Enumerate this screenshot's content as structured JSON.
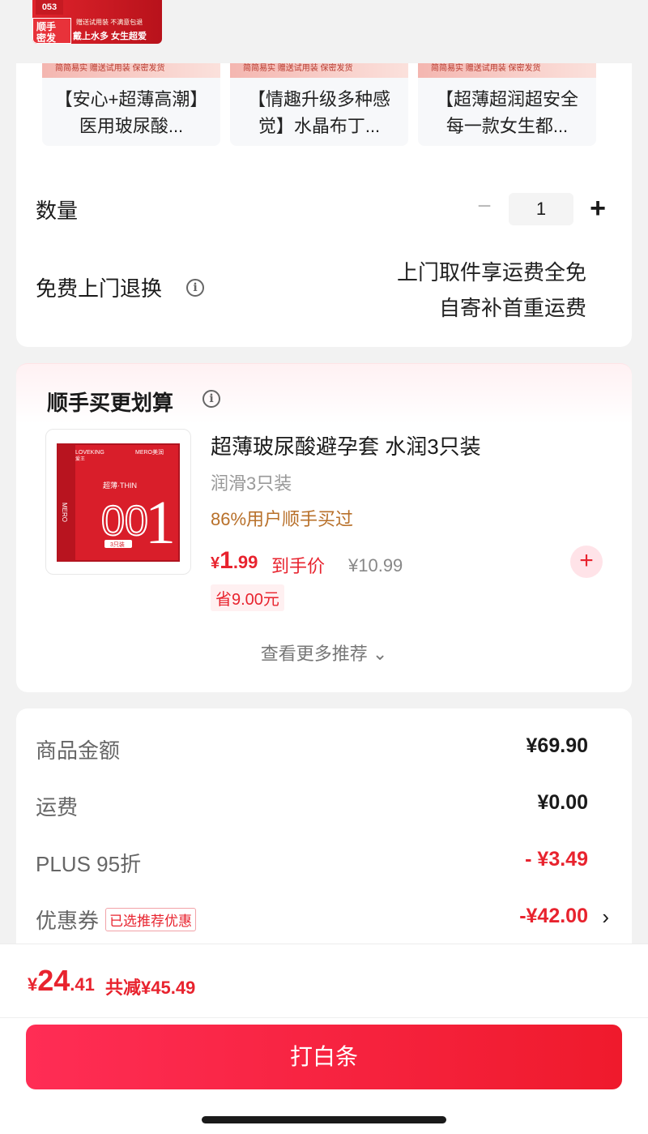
{
  "top_banner": {
    "num_tag": "053",
    "tag_line1": "顺手",
    "tag_line2": "密发",
    "sub_line": "赠送试用装 不满意包退",
    "promo_line": "戴上水多 女生超爱"
  },
  "recommend_strip": [
    {
      "strip": "简简易实 赠送试用装 保密发货",
      "title": "【安心+超薄高潮】医用玻尿酸..."
    },
    {
      "strip": "简简易实 赠送试用装 保密发货",
      "title": "【情趣升级多种感觉】水晶布丁..."
    },
    {
      "strip": "简简易实 赠送试用装 保密发货",
      "title": "【超薄超润超安全每一款女生都..."
    }
  ],
  "quantity": {
    "label": "数量",
    "minus": "−",
    "value": "1",
    "plus": "+"
  },
  "return_service": {
    "label": "免费上门退换",
    "info_icon": "info-icon",
    "desc_line1": "上门取件享运费全免",
    "desc_line2": "自寄补首重运费"
  },
  "addon": {
    "header": "顺手买更划算",
    "product": {
      "name": "超薄玻尿酸避孕套 水润3只装",
      "spec": "润滑3只装",
      "social": "86%用户顺手买过",
      "price_yen": "¥",
      "price_int": "1",
      "price_dec": ".99",
      "price_tag": "到手价",
      "original_price": "¥10.99",
      "save": "省9.00元",
      "add_icon": "plus-icon",
      "image": {
        "brand1": "LOVEKING 爱王",
        "brand2": "MERO 美润",
        "thin_label": "超薄·THIN",
        "big_num": "001",
        "count": "3只装"
      }
    },
    "more": "查看更多推荐 ⌄"
  },
  "summary": {
    "rows": [
      {
        "label": "商品金额",
        "value": "¥69.90"
      },
      {
        "label": "运费",
        "value": "¥0.00"
      },
      {
        "label": "PLUS 95折",
        "value": "- ¥3.49"
      },
      {
        "label": "优惠券",
        "tag": "已选推荐优惠",
        "value": "-¥42.00",
        "chevron": "›"
      }
    ]
  },
  "bottom": {
    "yen": "¥",
    "int": "24",
    "dec": ".41",
    "total_save": "共减¥45.49",
    "pay_button": "打白条"
  },
  "colors": {
    "accent_red": "#e8232e",
    "button_gradient_start": "#ff2d55",
    "button_gradient_end": "#ef1a2c"
  }
}
